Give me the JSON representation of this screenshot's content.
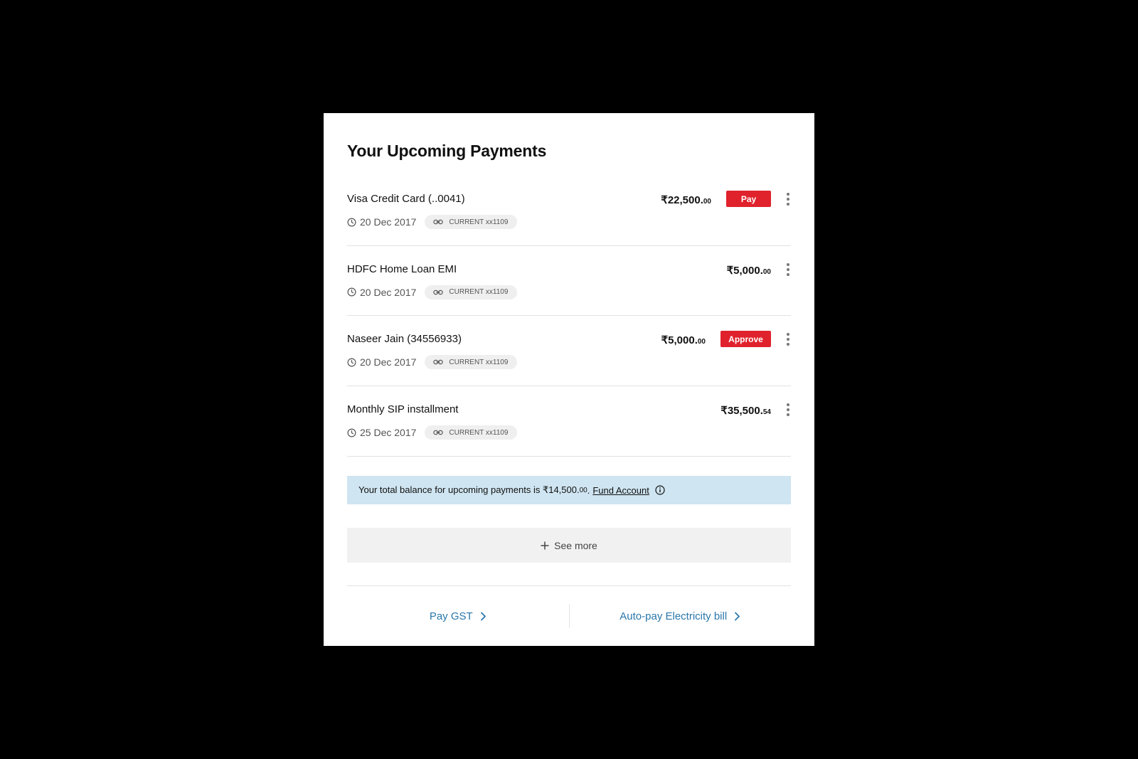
{
  "card": {
    "title": "Your Upcoming Payments"
  },
  "payments": [
    {
      "name": "Visa Credit Card (..0041)",
      "date": "20 Dec 2017",
      "account": "CURRENT xx1109",
      "amount_main": "₹22,500.",
      "amount_dec": "00",
      "action": "Pay"
    },
    {
      "name": "HDFC Home Loan EMI",
      "date": "20 Dec 2017",
      "account": "CURRENT xx1109",
      "amount_main": "₹5,000.",
      "amount_dec": "00",
      "action": ""
    },
    {
      "name": "Naseer Jain (34556933)",
      "date": "20 Dec 2017",
      "account": "CURRENT xx1109",
      "amount_main": "₹5,000.",
      "amount_dec": "00",
      "action": "Approve"
    },
    {
      "name": "Monthly SIP installment",
      "date": "25 Dec 2017",
      "account": "CURRENT xx1109",
      "amount_main": "₹35,500.",
      "amount_dec": "54",
      "action": ""
    }
  ],
  "banner": {
    "text": "Your total balance for upcoming payments is ₹14,500.",
    "amount_dec": "00",
    "suffix": ".",
    "link": "Fund Account",
    "icon": "info-icon"
  },
  "see_more": {
    "label": "See more",
    "icon": "plus-icon"
  },
  "footer": {
    "left_link": "Pay GST",
    "right_link": "Auto-pay Electricity bill",
    "icon": "chevron-right-icon"
  },
  "colors": {
    "accent_red": "#e0222d",
    "link_blue": "#2a77ab",
    "banner_bg": "#cfe5f1",
    "page_bg": "#000000"
  }
}
